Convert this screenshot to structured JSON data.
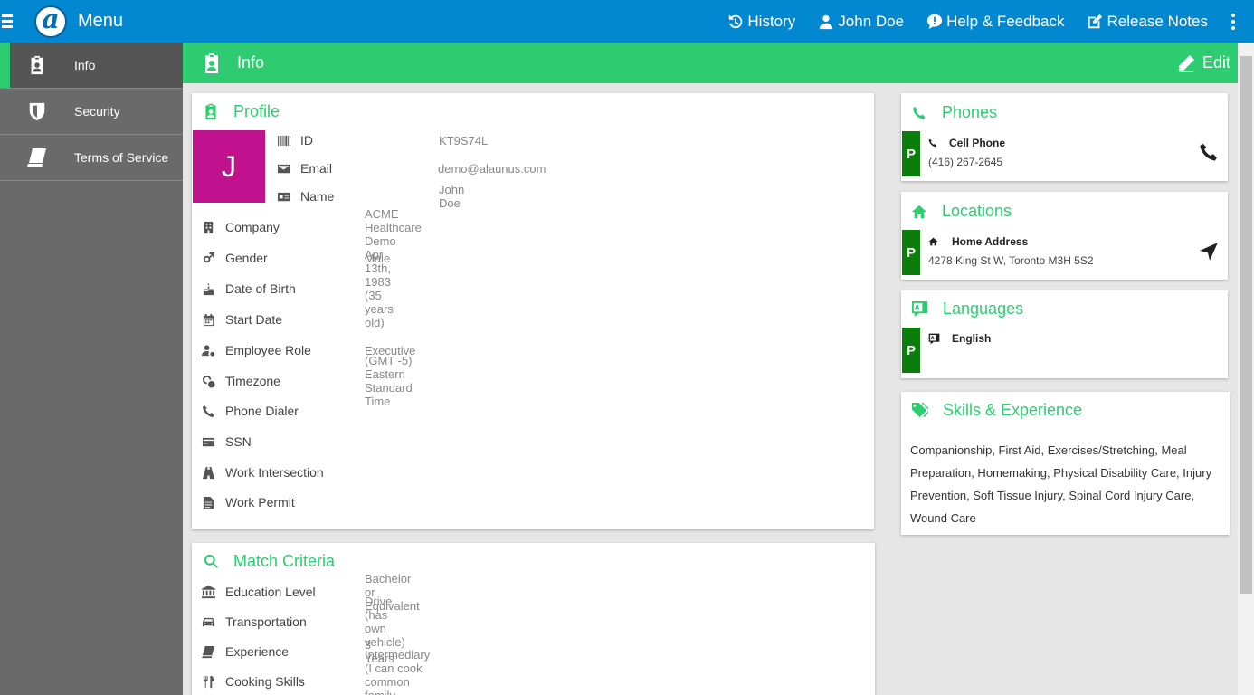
{
  "topbar": {
    "menu_label": "Menu",
    "logo_letter": "a",
    "links": {
      "history": "History",
      "user": "John Doe",
      "help": "Help & Feedback",
      "release": "Release Notes"
    }
  },
  "sidebar": {
    "items": [
      {
        "label": "Info",
        "icon": "id-badge-icon"
      },
      {
        "label": "Security",
        "icon": "shield-icon"
      },
      {
        "label": "Terms of Service",
        "icon": "book-icon"
      }
    ]
  },
  "header": {
    "title": "Info",
    "edit_label": "Edit"
  },
  "profile": {
    "title": "Profile",
    "avatar_letter": "J",
    "avatar_color": "#c0128e",
    "top_fields": [
      {
        "label": "ID",
        "value": "KT9S74L"
      },
      {
        "label": "Email",
        "value": "demo@alaunus.com"
      },
      {
        "label": "Name",
        "value": "John Doe"
      }
    ],
    "fields": [
      {
        "label": "Company",
        "value": "ACME Healthcare Demo"
      },
      {
        "label": "Gender",
        "value": "Male"
      },
      {
        "label": "Date of Birth",
        "value": "Apr 13th, 1983 (35 years old)"
      },
      {
        "label": "Start Date",
        "value": ""
      },
      {
        "label": "Employee Role",
        "value": "Executive"
      },
      {
        "label": "Timezone",
        "value": "(GMT -5) Eastern Standard Time"
      },
      {
        "label": "Phone Dialer",
        "value": ""
      },
      {
        "label": "SSN",
        "value": ""
      },
      {
        "label": "Work Intersection",
        "value": ""
      },
      {
        "label": "Work Permit",
        "value": ""
      }
    ]
  },
  "match": {
    "title": "Match Criteria",
    "fields": [
      {
        "label": "Education Level",
        "value": "Bachelor or Equivalent"
      },
      {
        "label": "Transportation",
        "value": "Drive (has own vehicle)"
      },
      {
        "label": "Experience",
        "value": "3 Years"
      },
      {
        "label": "Cooking Skills",
        "value": "Intermediary (I can cook common family dinners)"
      }
    ]
  },
  "phones": {
    "title": "Phones",
    "badge": "P",
    "item_title": "Cell Phone",
    "item_value": "(416) 267-2645"
  },
  "locations": {
    "title": "Locations",
    "badge": "P",
    "item_title": "Home Address",
    "item_value": "4278 King St W, Toronto M3H 5S2"
  },
  "languages": {
    "title": "Languages",
    "badge": "P",
    "item_title": "English"
  },
  "skills": {
    "title": "Skills & Experience",
    "text": "Companionship, First Aid, Exercises/Stretching, Meal Preparation, Homemaking, Physical Disability Care, Injury Prevention, Soft Tissue Injury, Spinal Cord Injury Care, Wound Care"
  },
  "colors": {
    "topbar": "#0288d1",
    "accent": "#2ecc71",
    "badge": "#0a7d0a",
    "sidebar": "#6a6a6a"
  }
}
